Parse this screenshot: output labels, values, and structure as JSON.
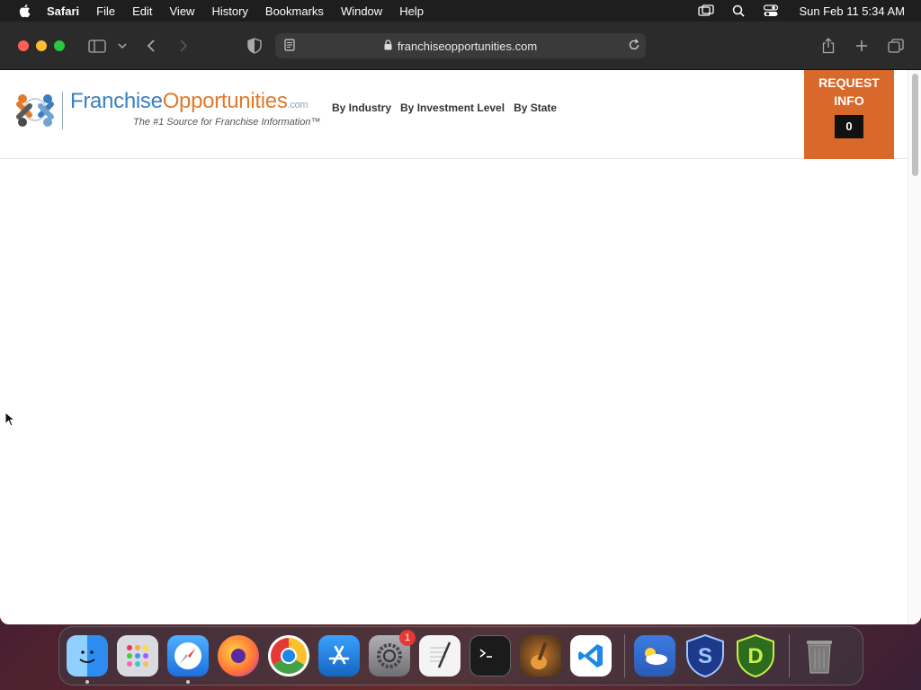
{
  "menubar": {
    "app_name": "Safari",
    "items": [
      "File",
      "Edit",
      "View",
      "History",
      "Bookmarks",
      "Window",
      "Help"
    ],
    "clock": "Sun Feb 11  5:34 AM"
  },
  "browser": {
    "url": "franchiseopportunities.com"
  },
  "site": {
    "logo": {
      "brand_part1": "Franchise",
      "brand_part2": "Opportunities",
      "brand_suffix": ".com",
      "tagline": "The #1 Source for Franchise Information™"
    },
    "nav": [
      "By Industry",
      "By Investment Level",
      "By State"
    ],
    "request": {
      "label_line1": "REQUEST",
      "label_line2": "INFO",
      "count": "0"
    }
  },
  "dock": {
    "apps": [
      {
        "name": "Finder",
        "icon": "finder-icon",
        "color": "#2d8cf0"
      },
      {
        "name": "Launchpad",
        "icon": "launchpad-icon",
        "color": "#9aa0a6"
      },
      {
        "name": "Safari",
        "icon": "safari-icon",
        "color": "#2f7de1"
      },
      {
        "name": "Firefox",
        "icon": "firefox-icon",
        "color": "#ff7139"
      },
      {
        "name": "Chrome",
        "icon": "chrome-icon",
        "color": "#ffffff"
      },
      {
        "name": "App Store",
        "icon": "app-store-icon",
        "color": "#1e88e5"
      },
      {
        "name": "System Settings",
        "icon": "settings-icon",
        "color": "#8e8e93",
        "badge": "1"
      },
      {
        "name": "TextEdit",
        "icon": "textedit-icon",
        "color": "#f4f4f4"
      },
      {
        "name": "Terminal",
        "icon": "terminal-icon",
        "color": "#1b1b1b"
      },
      {
        "name": "GarageBand",
        "icon": "garageband-icon",
        "color": "#3a2a1a"
      },
      {
        "name": "VS Code",
        "icon": "vscode-icon",
        "color": "#ffffff"
      },
      {
        "name": "Weather",
        "icon": "weather-icon",
        "color": "#3d7be0"
      },
      {
        "name": "S App",
        "icon": "s-shield-icon",
        "color": "#1d3a8a"
      },
      {
        "name": "D App",
        "icon": "d-shield-icon",
        "color": "#2d6b1f"
      },
      {
        "name": "Trash",
        "icon": "trash-icon",
        "color": "#8a8a8a"
      }
    ]
  }
}
